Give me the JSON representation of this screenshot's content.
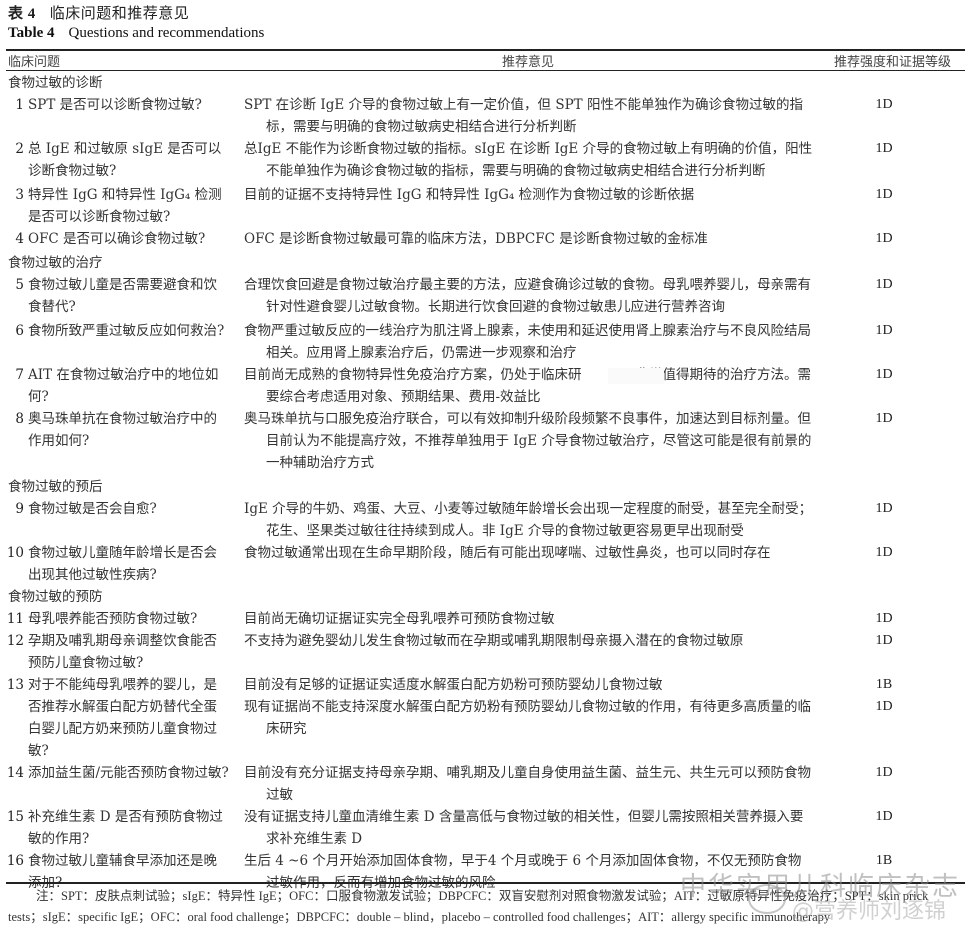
{
  "title": {
    "cn_num": "表 4",
    "cn_text": "临床问题和推荐意见",
    "en_num": "Table 4",
    "en_text": "Questions and recommendations"
  },
  "headers": {
    "question": "临床问题",
    "recommendation": "推荐意见",
    "grade": "推荐强度和证据等级"
  },
  "sections": [
    {
      "title": "食物过敏的诊断",
      "rows": [
        {
          "num": "1",
          "question": "SPT 是否可以诊断食物过敏?",
          "recommendation": "SPT 在诊断 IgE 介导的食物过敏上有一定价值，但 SPT 阳性不能单独作为确诊食物过敏的指标，需要与明确的食物过敏病史相结合进行分析判断",
          "grade": "1D"
        },
        {
          "num": "2",
          "question": "总 IgE 和过敏原 sIgE 是否可以诊断食物过敏?",
          "recommendation": "总IgE 不能作为诊断食物过敏的指标。sIgE 在诊断 IgE 介导的食物过敏上有明确的价值，阳性不能单独作为确诊食物过敏的指标，需要与明确的食物过敏病史相结合进行分析判断",
          "grade": "1D"
        },
        {
          "num": "3",
          "question": "特异性 IgG 和特异性 IgG₄ 检测是否可以诊断食物过敏?",
          "recommendation": "目前的证据不支持特异性 IgG 和特异性 IgG₄ 检测作为食物过敏的诊断依据",
          "grade": "1D"
        },
        {
          "num": "4",
          "question": "OFC 是否可以确诊食物过敏?",
          "recommendation": "OFC 是诊断食物过敏最可靠的临床方法，DBPCFC 是诊断食物过敏的金标准",
          "grade": "1D"
        }
      ]
    },
    {
      "title": "食物过敏的治疗",
      "rows": [
        {
          "num": "5",
          "question": "食物过敏儿童是否需要避食和饮食替代?",
          "recommendation": "合理饮食回避是食物过敏治疗最主要的方法，应避食确诊过敏的食物。母乳喂养婴儿，母亲需有针对性避食婴儿过敏食物。长期进行饮食回避的食物过敏患儿应进行营养咨询",
          "grade": "1D"
        },
        {
          "num": "6",
          "question": "食物所致严重过敏反应如何救治?",
          "recommendation": "食物严重过敏反应的一线治疗为肌注肾上腺素，未使用和延迟使用肾上腺素治疗与不良风险结局相关。应用肾上腺素治疗后，仍需进一步观察和治疗",
          "grade": "1D"
        },
        {
          "num": "7",
          "question": "AIT 在食物过敏治疗中的地位如何?",
          "recommendation": "目前尚无成熟的食物特异性免疫治疗方案，仍处于临床研　　　　非常值得期待的治疗方法。需要综合考虑适用对象、预期结果、费用-效益比",
          "grade": "1D"
        },
        {
          "num": "8",
          "question": "奥马珠单抗在食物过敏治疗中的作用如何?",
          "recommendation": "奥马珠单抗与口服免疫治疗联合，可以有效抑制升级阶段频繁不良事件，加速达到目标剂量。但目前认为不能提高疗效，不推荐单独用于 IgE 介导食物过敏治疗，尽管这可能是很有前景的一种辅助治疗方式",
          "grade": "1D"
        }
      ]
    },
    {
      "title": "食物过敏的预后",
      "rows": [
        {
          "num": "9",
          "question": "食物过敏是否会自愈?",
          "recommendation": "IgE 介导的牛奶、鸡蛋、大豆、小麦等过敏随年龄增长会出现一定程度的耐受，甚至完全耐受；花生、坚果类过敏往往持续到成人。非 IgE 介导的食物过敏更容易更早出现耐受",
          "grade": "1D"
        },
        {
          "num": "10",
          "question": "食物过敏儿童随年龄增长是否会出现其他过敏性疾病?",
          "recommendation": "食物过敏通常出现在生命早期阶段，随后有可能出现哮喘、过敏性鼻炎，也可以同时存在",
          "grade": "1D"
        }
      ]
    },
    {
      "title": "食物过敏的预防",
      "rows": [
        {
          "num": "11",
          "question": "母乳喂养能否预防食物过敏?",
          "recommendation": "目前尚无确切证据证实完全母乳喂养可预防食物过敏",
          "grade": "1D"
        },
        {
          "num": "12",
          "question": "孕期及哺乳期母亲调整饮食能否预防儿童食物过敏?",
          "recommendation": "不支持为避免婴幼儿发生食物过敏而在孕期或哺乳期限制母亲摄入潜在的食物过敏原",
          "grade": "1D"
        },
        {
          "num": "13",
          "question": "对于不能纯母乳喂养的婴儿，是否推荐水解蛋白配方奶替代全蛋白婴儿配方奶来预防儿童食物过敏?",
          "recommendation": "目前没有足够的证据证实适度水解蛋白配方奶粉可预防婴幼儿食物过敏",
          "grade": "1B",
          "extra": {
            "recommendation": "现有证据尚不能支持深度水解蛋白配方奶粉有预防婴幼儿食物过敏的作用，有待更多高质量的临床研究",
            "grade": "1D"
          }
        },
        {
          "num": "14",
          "question": "添加益生菌/元能否预防食物过敏?",
          "recommendation": "目前没有充分证据支持母亲孕期、哺乳期及儿童自身使用益生菌、益生元、共生元可以预防食物过敏",
          "grade": "1D"
        },
        {
          "num": "15",
          "question": "补充维生素 D 是否有预防食物过敏的作用?",
          "recommendation": "没有证据支持儿童血清维生素 D 含量高低与食物过敏的相关性，但婴儿需按照相关营养摄入要求补充维生素 D",
          "grade": "1D"
        },
        {
          "num": "16",
          "question": "食物过敏儿童辅食早添加还是晚添加?",
          "recommendation": "生后 4 ~6 个月开始添加固体食物，早于4 个月或晚于 6 个月添加固体食物，不仅无预防食物过敏作用，反而有增加食物过敏的风险",
          "grade": "1B"
        }
      ]
    }
  ],
  "note": {
    "line1": "注：SPT：皮肤点刺试验；sIgE：特异性 IgE；OFC：口服食物激发试验；DBPCFC：双盲安慰剂对照食物激发试验；AIT：过敏原特异性免疫治疗；SPT：skin prick",
    "line2": "tests；sIgE：specific IgE；OFC：oral food challenge；DBPCFC：double – blind，placebo – controlled food challenges；AIT：allergy specific immunotherapy"
  },
  "watermark": {
    "line1": "中华实用儿科临床杂志",
    "line2": "@营养师刘逐锦"
  }
}
